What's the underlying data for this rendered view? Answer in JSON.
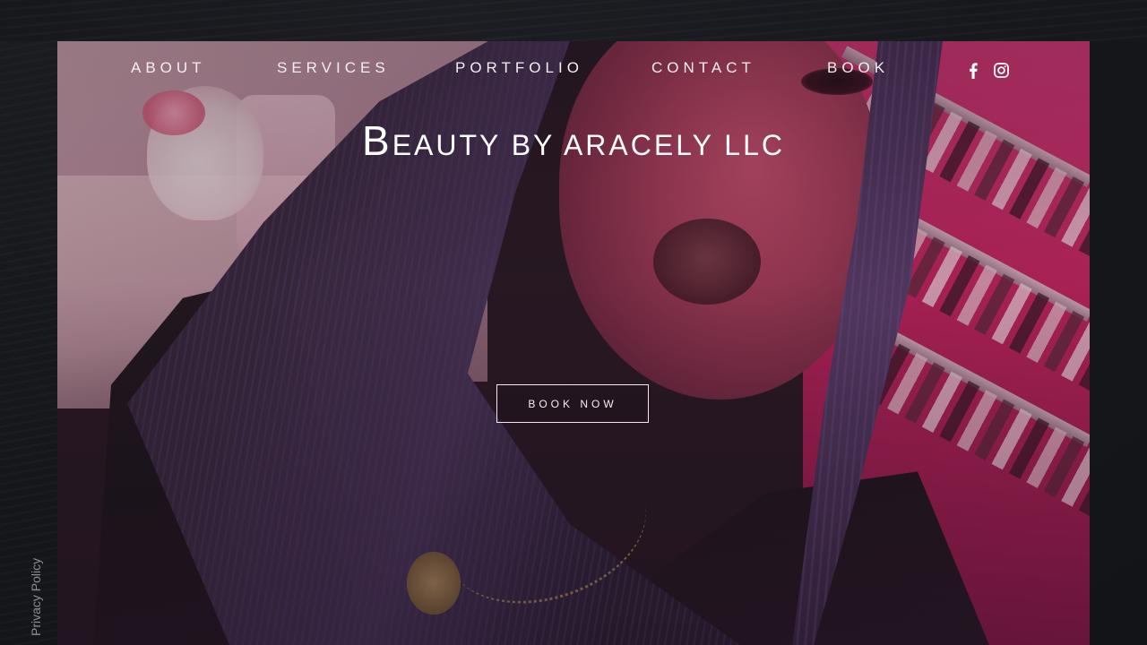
{
  "site": {
    "title_initial": "B",
    "title_rest": "EAUTY BY ARACELY LLC"
  },
  "nav": {
    "items": [
      {
        "label": "ABOUT"
      },
      {
        "label": "SERVICES"
      },
      {
        "label": "PORTFOLIO"
      },
      {
        "label": "CONTACT"
      },
      {
        "label": "BOOK"
      }
    ]
  },
  "social": {
    "icons": [
      "facebook-icon",
      "instagram-icon"
    ]
  },
  "hero": {
    "cta_label": "BOOK NOW"
  },
  "footer": {
    "privacy_label": "Privacy Policy"
  },
  "colors": {
    "background": "#16181d",
    "nav_text": "#f4eef2",
    "accent_pink": "#d63a78",
    "privacy_text": "#8a8d94"
  }
}
